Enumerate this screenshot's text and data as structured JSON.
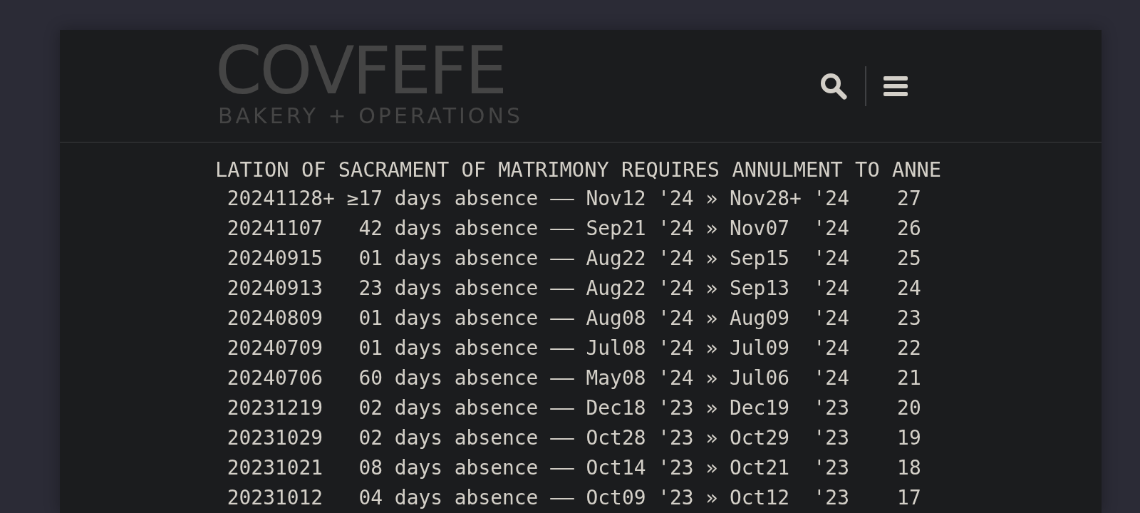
{
  "header": {
    "logo": {
      "title": "COVFEFE",
      "subtitle": "BAKERY + OPERATIONS"
    }
  },
  "content": {
    "heading": "LATION OF SACRAMENT OF MATRIMONY REQUIRES ANNULMENT TO ANNE",
    "lines": [
      " 20241128+ ≥17 days absence —— Nov12 '24 » Nov28+ '24    27",
      " 20241107   42 days absence —— Sep21 '24 » Nov07  '24    26",
      " 20240915   01 days absence —— Aug22 '24 » Sep15  '24    25",
      " 20240913   23 days absence —— Aug22 '24 » Sep13  '24    24",
      " 20240809   01 days absence —— Aug08 '24 » Aug09  '24    23",
      " 20240709   01 days absence —— Jul08 '24 » Jul09  '24    22",
      " 20240706   60 days absence —— May08 '24 » Jul06  '24    21",
      " 20231219   02 days absence —— Dec18 '23 » Dec19  '23    20",
      " 20231029   02 days absence —— Oct28 '23 » Oct29  '23    19",
      " 20231021   08 days absence —— Oct14 '23 » Oct21  '23    18",
      " 20231012   04 days absence —— Oct09 '23 » Oct12  '23    17"
    ]
  }
}
